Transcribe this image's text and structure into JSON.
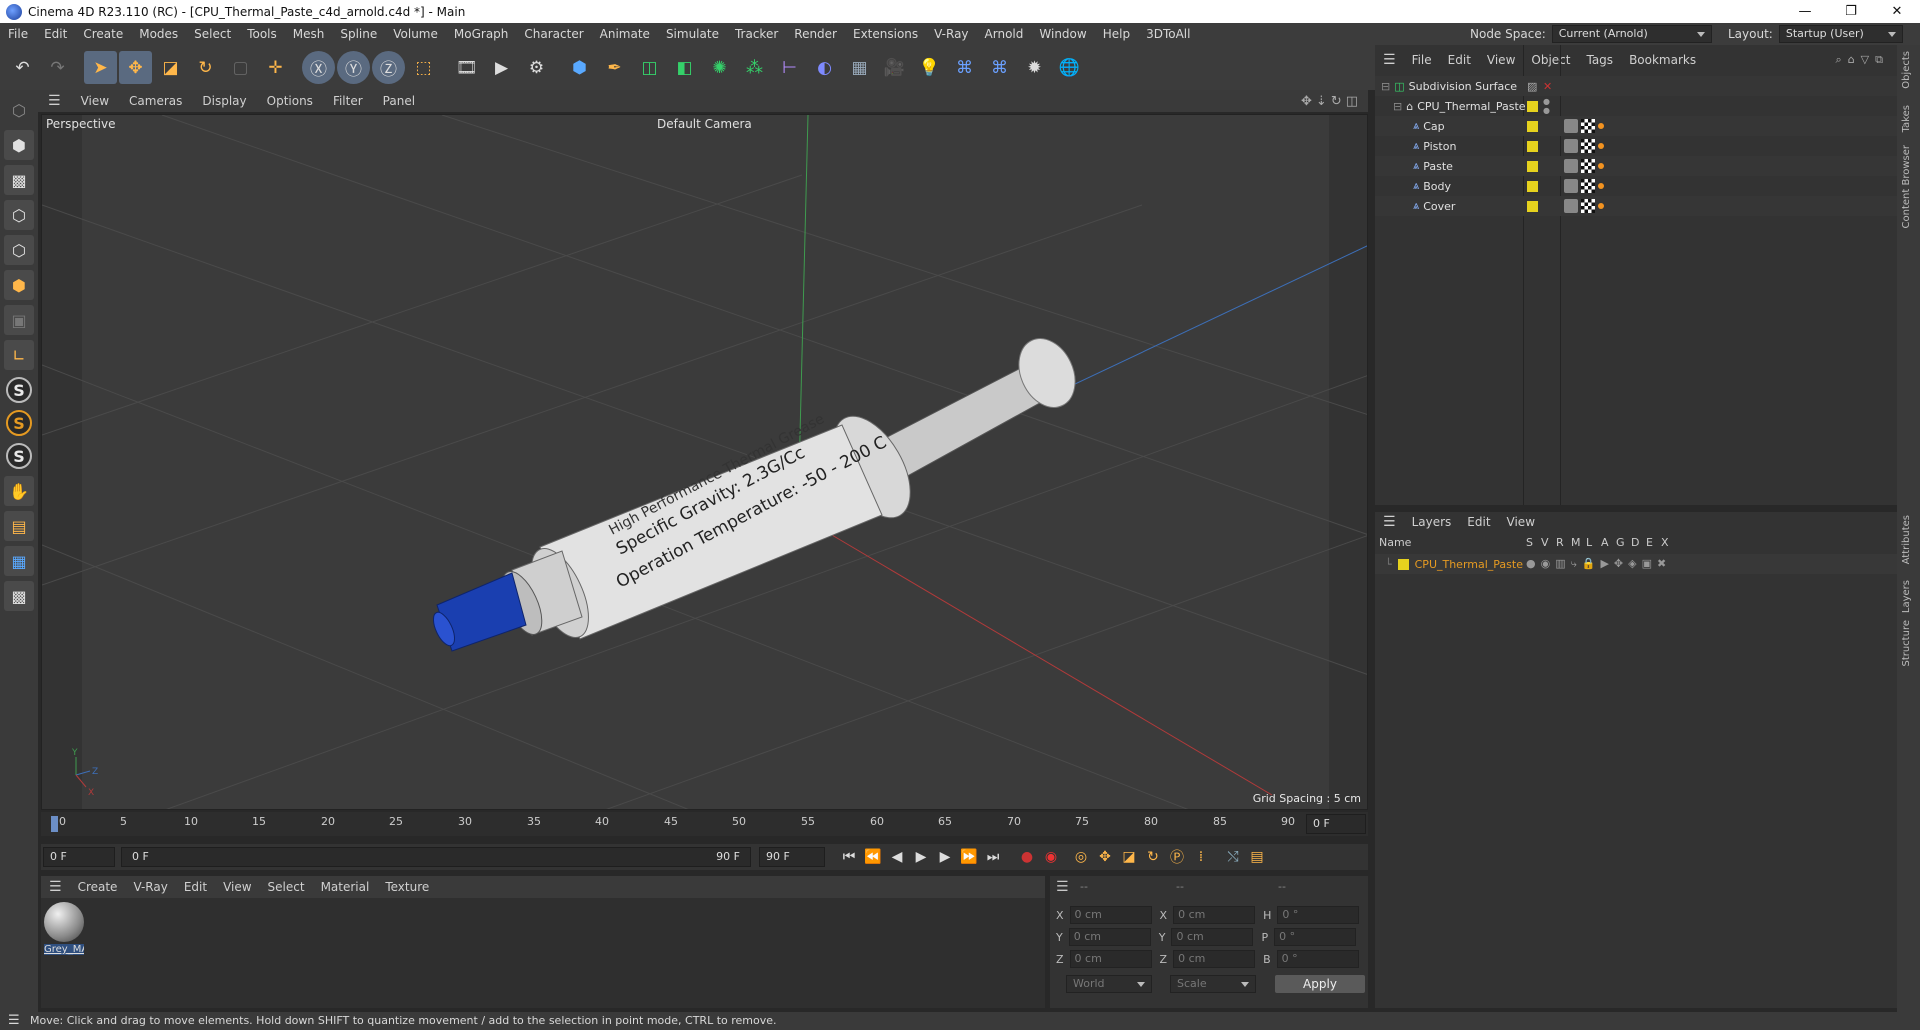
{
  "window": {
    "title": "Cinema 4D R23.110 (RC) - [CPU_Thermal_Paste_c4d_arnold.c4d *] - Main",
    "min": "—",
    "max": "❐",
    "close": "✕"
  },
  "menu": [
    "File",
    "Edit",
    "Create",
    "Modes",
    "Select",
    "Tools",
    "Mesh",
    "Spline",
    "Volume",
    "MoGraph",
    "Character",
    "Animate",
    "Simulate",
    "Tracker",
    "Render",
    "Extensions",
    "V-Ray",
    "Arnold",
    "Window",
    "Help",
    "3DToAll"
  ],
  "nodespace": {
    "label": "Node Space:",
    "value": "Current (Arnold)"
  },
  "layout": {
    "label": "Layout:",
    "value": "Startup (User)"
  },
  "viewport": {
    "menu": [
      "View",
      "Cameras",
      "Display",
      "Options",
      "Filter",
      "Panel"
    ],
    "label": "Perspective",
    "camera": "Default Camera",
    "grid": "Grid Spacing : 5 cm",
    "texts": [
      "High Performance Thermal Grease",
      "Specific Gravity: 2.3G/Cc",
      "Operation Temperature: -50 - 200 C"
    ]
  },
  "timeline": {
    "ticks": [
      "0",
      "5",
      "10",
      "15",
      "20",
      "25",
      "30",
      "35",
      "40",
      "45",
      "50",
      "55",
      "60",
      "65",
      "70",
      "75",
      "80",
      "85",
      "90"
    ],
    "current": "0 F"
  },
  "transport": {
    "start": "0 F",
    "range_start": "0 F",
    "range_end": "90 F",
    "end": "90 F"
  },
  "materials": {
    "menu": [
      "Create",
      "V-Ray",
      "Edit",
      "View",
      "Select",
      "Material",
      "Texture"
    ],
    "items": [
      {
        "name": "Grey_MA"
      }
    ]
  },
  "coords": {
    "headers": [
      "--",
      "--",
      "--"
    ],
    "rows": [
      {
        "a": "X",
        "av": "0 cm",
        "b": "X",
        "bv": "0 cm",
        "c": "H",
        "cv": "0 °"
      },
      {
        "a": "Y",
        "av": "0 cm",
        "b": "Y",
        "bv": "0 cm",
        "c": "P",
        "cv": "0 °"
      },
      {
        "a": "Z",
        "av": "0 cm",
        "b": "Z",
        "bv": "0 cm",
        "c": "B",
        "cv": "0 °"
      }
    ],
    "mode1": "World",
    "mode2": "Scale",
    "apply": "Apply"
  },
  "objects": {
    "menu": [
      "File",
      "Edit",
      "View",
      "Object",
      "Tags",
      "Bookmarks"
    ],
    "items": [
      {
        "name": "Subdivision Surface"
      },
      {
        "name": "CPU_Thermal_Paste"
      },
      {
        "name": "Cap"
      },
      {
        "name": "Piston"
      },
      {
        "name": "Paste"
      },
      {
        "name": "Body"
      },
      {
        "name": "Cover"
      }
    ]
  },
  "layers": {
    "menu": [
      "Layers",
      "Edit",
      "View"
    ],
    "columns": [
      "Name",
      "S",
      "V",
      "R",
      "M",
      "L",
      "A",
      "G",
      "D",
      "E",
      "X"
    ],
    "items": [
      {
        "name": "CPU_Thermal_Paste"
      }
    ]
  },
  "side_tabs": [
    "Objects",
    "Takes",
    "Content Browser",
    "Attributes",
    "Layers",
    "Structure"
  ],
  "status": "Move: Click and drag to move elements. Hold down SHIFT to quantize movement / add to the selection in point mode, CTRL to remove."
}
